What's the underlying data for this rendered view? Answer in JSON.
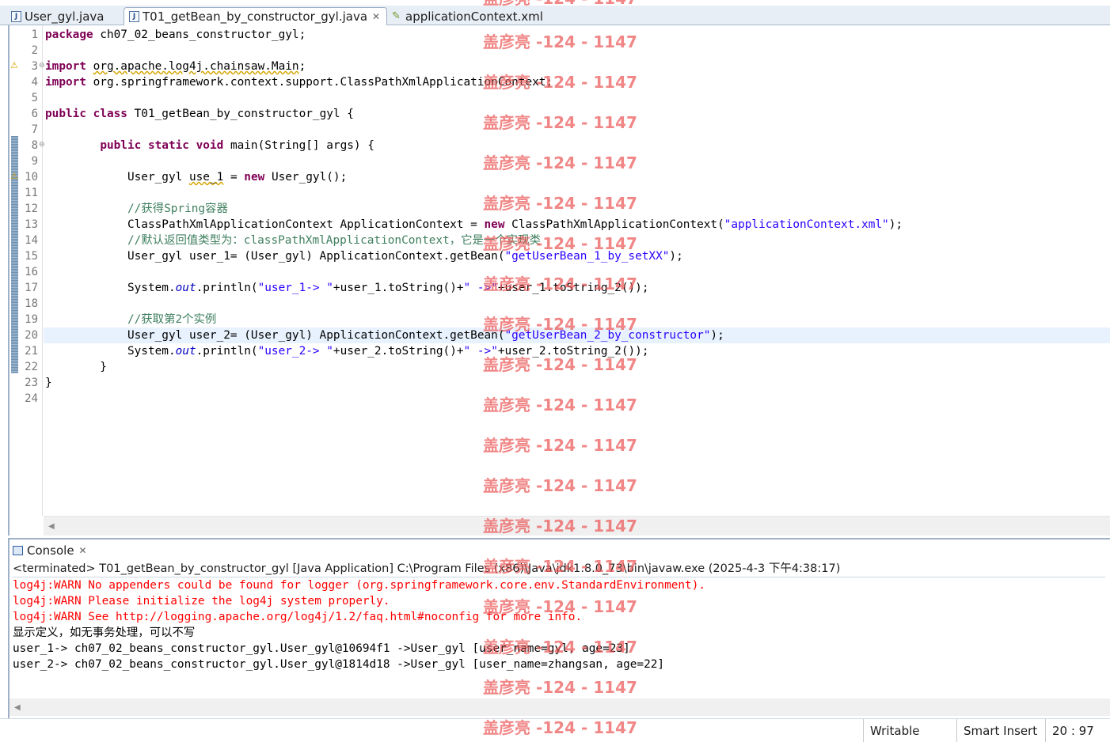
{
  "tabs": [
    {
      "label": "User_gyl.java",
      "icon": "java-file-icon",
      "active": false
    },
    {
      "label": "T01_getBean_by_constructor_gyl.java",
      "icon": "java-file-icon",
      "active": true
    },
    {
      "label": "applicationContext.xml",
      "icon": "xml-file-icon",
      "active": false
    }
  ],
  "editor": {
    "line_numbers": [
      "1",
      "2",
      "3",
      "4",
      "5",
      "6",
      "7",
      "8",
      "9",
      "10",
      "11",
      "12",
      "13",
      "14",
      "15",
      "16",
      "17",
      "18",
      "19",
      "20",
      "21",
      "22",
      "23",
      "24"
    ],
    "lines": {
      "l1": {
        "kw": "package",
        "rest": " ch07_02_beans_constructor_gyl;"
      },
      "l3": {
        "kw": "import",
        "warn": "org.apache.log4j.chainsaw.Main",
        "rest": ";"
      },
      "l4": {
        "kw": "import",
        "rest": " org.springframework.context.support.ClassPathXmlApplicationContext;"
      },
      "l6": {
        "kw1": "public",
        "kw2": "class",
        "rest": " T01_getBean_by_constructor_gyl {"
      },
      "l8": {
        "indent": "        ",
        "kw1": "public",
        "kw2": "static",
        "kw3": "void",
        "rest": " main(String[] args) {"
      },
      "l10": {
        "a": "            User_gyl ",
        "warn": "use_1",
        "b": " = ",
        "kw": "new",
        "c": " User_gyl();"
      },
      "l12": {
        "cmt": "            //获得Spring容器"
      },
      "l13": {
        "a": "            ClassPathXmlApplicationContext ApplicationContext = ",
        "kw": "new",
        "b": " ClassPathXmlApplicationContext(",
        "str": "\"applicationContext.xml\"",
        "c": ");"
      },
      "l14": {
        "cmt": "            //默认返回值类型为：classPathXmlApplicationContext，它是一个实现类"
      },
      "l15": {
        "a": "            User_gyl user_1= (User_gyl) ApplicationContext.getBean(",
        "str": "\"getUserBean_1_by_setXX\"",
        "c": ");"
      },
      "l17": {
        "a": "            System.",
        "fld": "out",
        "b": ".println(",
        "s1": "\"user_1-> \"",
        "c": "+user_1.toString()+",
        "s2": "\" ->\"",
        "d": "+user_1.toString_2());"
      },
      "l19": {
        "cmt": "            //获取第2个实例"
      },
      "l20": {
        "a": "            User_gyl user_2= (User_gyl) ApplicationContext.getBean(",
        "str": "\"getUserBean_2_by_constructor\"",
        "c": ");"
      },
      "l21": {
        "a": "            System.",
        "fld": "out",
        "b": ".println(",
        "s1": "\"user_2-> \"",
        "c": "+user_2.toString()+",
        "s2": "\" ->\"",
        "d": "+user_2.toString_2());"
      },
      "l22": {
        "text": "        }"
      },
      "l23": {
        "text": "}"
      }
    }
  },
  "console": {
    "tab_label": "Console",
    "status": "<terminated> T01_getBean_by_constructor_gyl [Java Application] C:\\Program Files (x86)\\Java\\jdk1.8.0_73\\bin\\javaw.exe (2025-4-3 下午4:38:17)",
    "output": [
      {
        "text": "log4j:WARN No appenders could be found for logger (org.springframework.core.env.StandardEnvironment).",
        "type": "err"
      },
      {
        "text": "log4j:WARN Please initialize the log4j system properly.",
        "type": "err"
      },
      {
        "text": "log4j:WARN See http://logging.apache.org/log4j/1.2/faq.html#noconfig for more info.",
        "type": "err"
      },
      {
        "text": "显示定义，如无事务处理，可以不写",
        "type": "std"
      },
      {
        "text": "user_1-> ch07_02_beans_constructor_gyl.User_gyl@10694f1 ->User_gyl [user_name=gyl, age=23]",
        "type": "std"
      },
      {
        "text": "user_2-> ch07_02_beans_constructor_gyl.User_gyl@1814d18 ->User_gyl [user_name=zhangsan, age=22]",
        "type": "std"
      }
    ]
  },
  "statusbar": {
    "writable": "Writable",
    "insert_mode": "Smart Insert",
    "position": "20 : 97"
  },
  "watermark": {
    "text": "盖彦亮 -124 - 1147",
    "color": "#ec5858"
  },
  "colors": {
    "keyword": "#7f0055",
    "string": "#2a00ff",
    "comment": "#3f7f5f",
    "error": "#ff0000",
    "current_line": "#e8f2fe"
  }
}
